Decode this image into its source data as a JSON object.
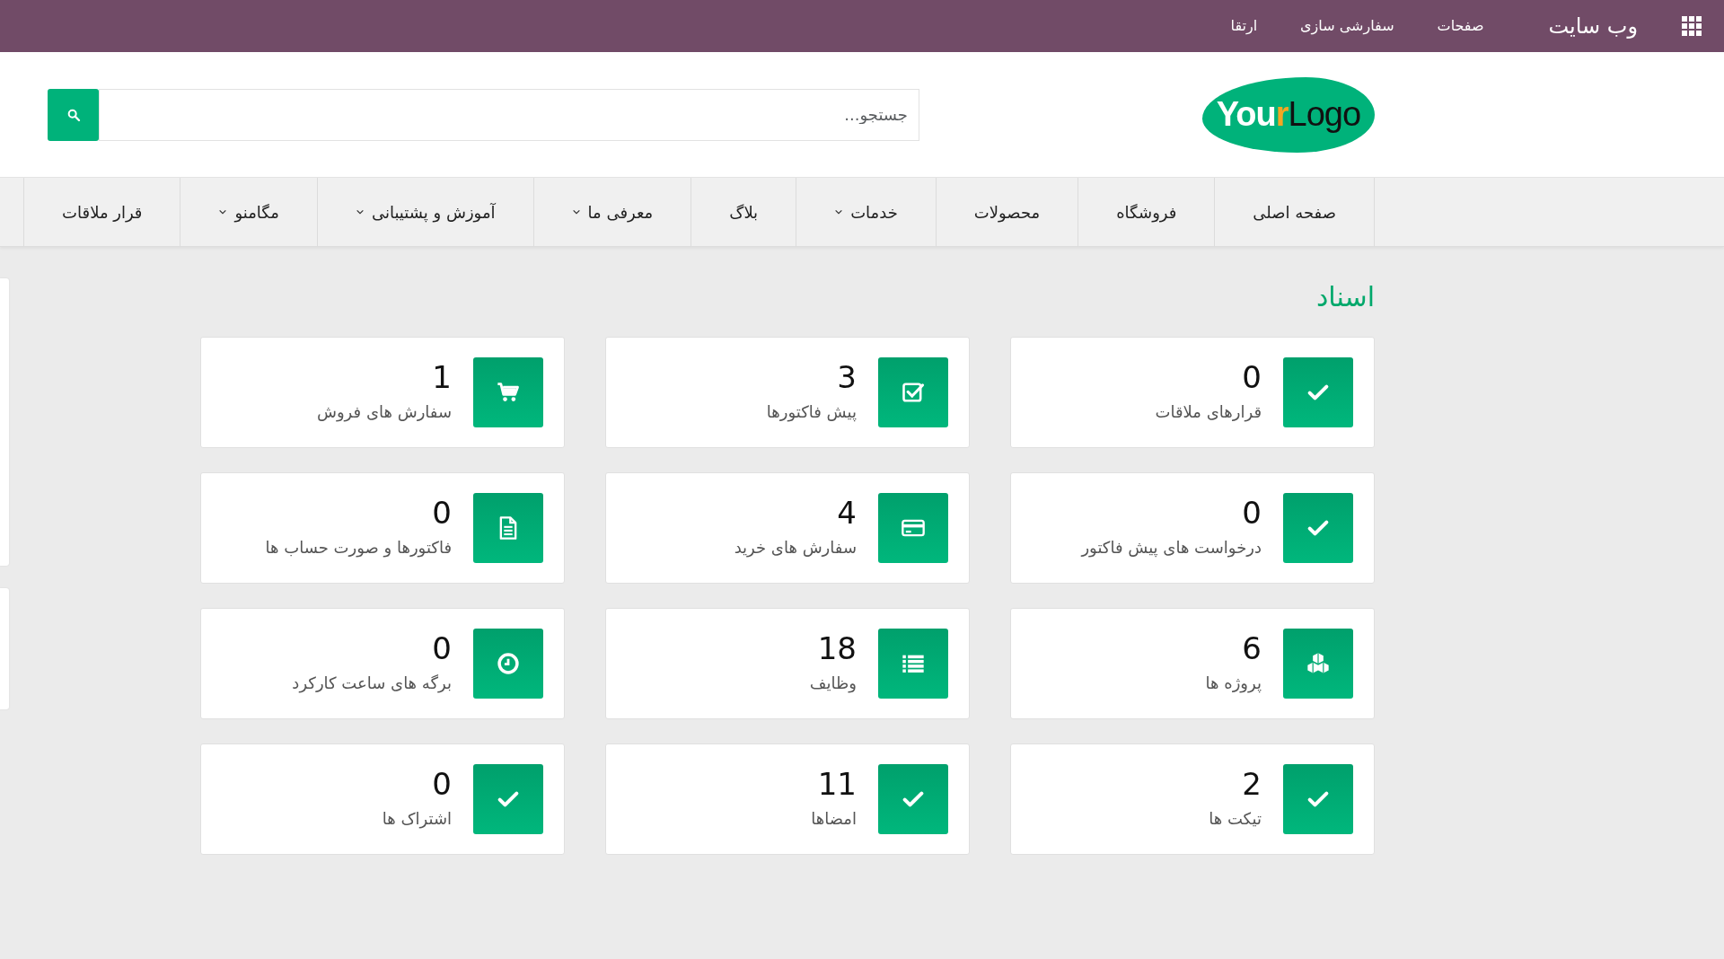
{
  "top_bar": {
    "title": "وب سایت",
    "menu": [
      "صفحات",
      "سفارشی سازی",
      "ارتقا"
    ]
  },
  "header": {
    "logo": {
      "part_1": "You",
      "part_2": "r",
      "part_3": "Logo"
    },
    "search": {
      "placeholder": "جستجو..."
    }
  },
  "nav": [
    {
      "label": "صفحه اصلی",
      "dropdown": false
    },
    {
      "label": "فروشگاه",
      "dropdown": false
    },
    {
      "label": "محصولات",
      "dropdown": false
    },
    {
      "label": "خدمات",
      "dropdown": true
    },
    {
      "label": "بلاگ",
      "dropdown": false
    },
    {
      "label": "معرفی ما",
      "dropdown": true
    },
    {
      "label": "آموزش و پشتیبانی",
      "dropdown": true
    },
    {
      "label": "مگامنو",
      "dropdown": true
    },
    {
      "label": "قرار ملاقات",
      "dropdown": false
    }
  ],
  "page_title": "اسناد",
  "documents": [
    {
      "count": "0",
      "label": "قرارهای ملاقات"
    },
    {
      "count": "3",
      "label": "پیش فاکتورها"
    },
    {
      "count": "1",
      "label": "سفارش های فروش"
    },
    {
      "count": "0",
      "label": "درخواست های پیش فاکتور"
    },
    {
      "count": "4",
      "label": "سفارش های خرید"
    },
    {
      "count": "0",
      "label": "فاکتورها و صورت حساب ها"
    },
    {
      "count": "6",
      "label": "پروژه ها"
    },
    {
      "count": "18",
      "label": "وظایف"
    },
    {
      "count": "0",
      "label": "برگه های ساعت کارکرد"
    },
    {
      "count": "2",
      "label": "تیکت ها"
    },
    {
      "count": "11",
      "label": "امضاها"
    },
    {
      "count": "0",
      "label": "اشتراک ها"
    }
  ]
}
